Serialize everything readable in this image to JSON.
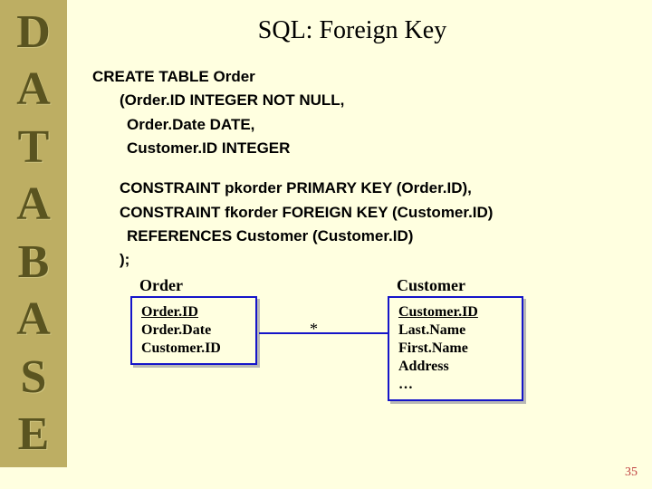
{
  "sidebar": {
    "letters": [
      "D",
      "A",
      "T",
      "A",
      "B",
      "A",
      "S",
      "E"
    ]
  },
  "title": "SQL: Foreign Key",
  "sql": {
    "l1": "CREATE TABLE Order",
    "l2": "(Order.ID INTEGER NOT NULL,",
    "l3": "Order.Date DATE,",
    "l4": "Customer.ID INTEGER",
    "l5": "CONSTRAINT pkorder PRIMARY KEY (Order.ID),",
    "l6": "CONSTRAINT fkorder FOREIGN KEY (Customer.ID)",
    "l7": "REFERENCES Customer (Customer.ID)",
    "l8": ");"
  },
  "diagram": {
    "order": {
      "label": "Order",
      "pk": "Order.ID",
      "f1": "Order.Date",
      "f2": "Customer.ID"
    },
    "customer": {
      "label": "Customer",
      "pk": "Customer.ID",
      "f1": "Last.Name",
      "f2": "First.Name",
      "f3": "Address",
      "f4": "…"
    },
    "cardinality": "*"
  },
  "page_number": "35"
}
